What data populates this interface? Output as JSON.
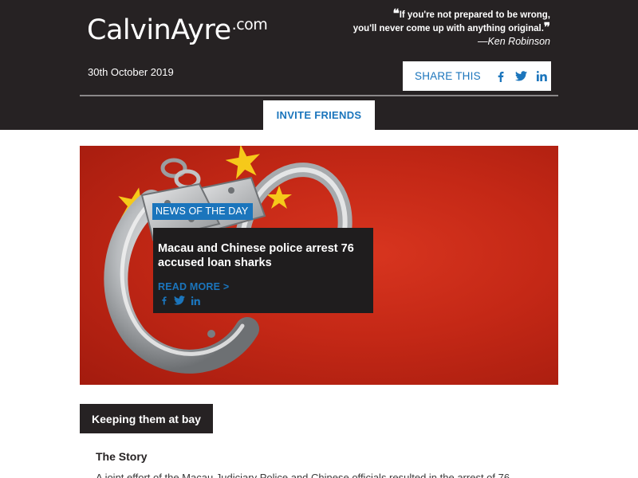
{
  "header": {
    "logo_main": "CalvinAyre",
    "logo_suffix": ".com",
    "quote_line1": "If you're not prepared to be wrong,",
    "quote_line2": "you'll never come up with anything original.",
    "quote_author": "—Ken Robinson",
    "date": "30th October 2019"
  },
  "share": {
    "label": "SHARE THIS",
    "icons": [
      "facebook-icon",
      "twitter-icon",
      "linkedin-icon"
    ]
  },
  "invite": {
    "label": "INVITE FRIENDS"
  },
  "news": {
    "badge": "NEWS OF THE DAY",
    "title": "Macau and Chinese police arrest 76 accused loan sharks",
    "read_more": "READ MORE >",
    "icons": [
      "facebook-icon",
      "twitter-icon",
      "linkedin-icon"
    ]
  },
  "section": {
    "tag": "Keeping them at bay",
    "story_heading": "The Story",
    "story_text": "A joint effort of the Macau Judiciary Police and Chinese officials resulted in the arrest of 76"
  },
  "colors": {
    "header_bg": "#262223",
    "accent_blue": "#1b75bc",
    "flag_red": "#c42816",
    "flag_star": "#f6c91a"
  }
}
